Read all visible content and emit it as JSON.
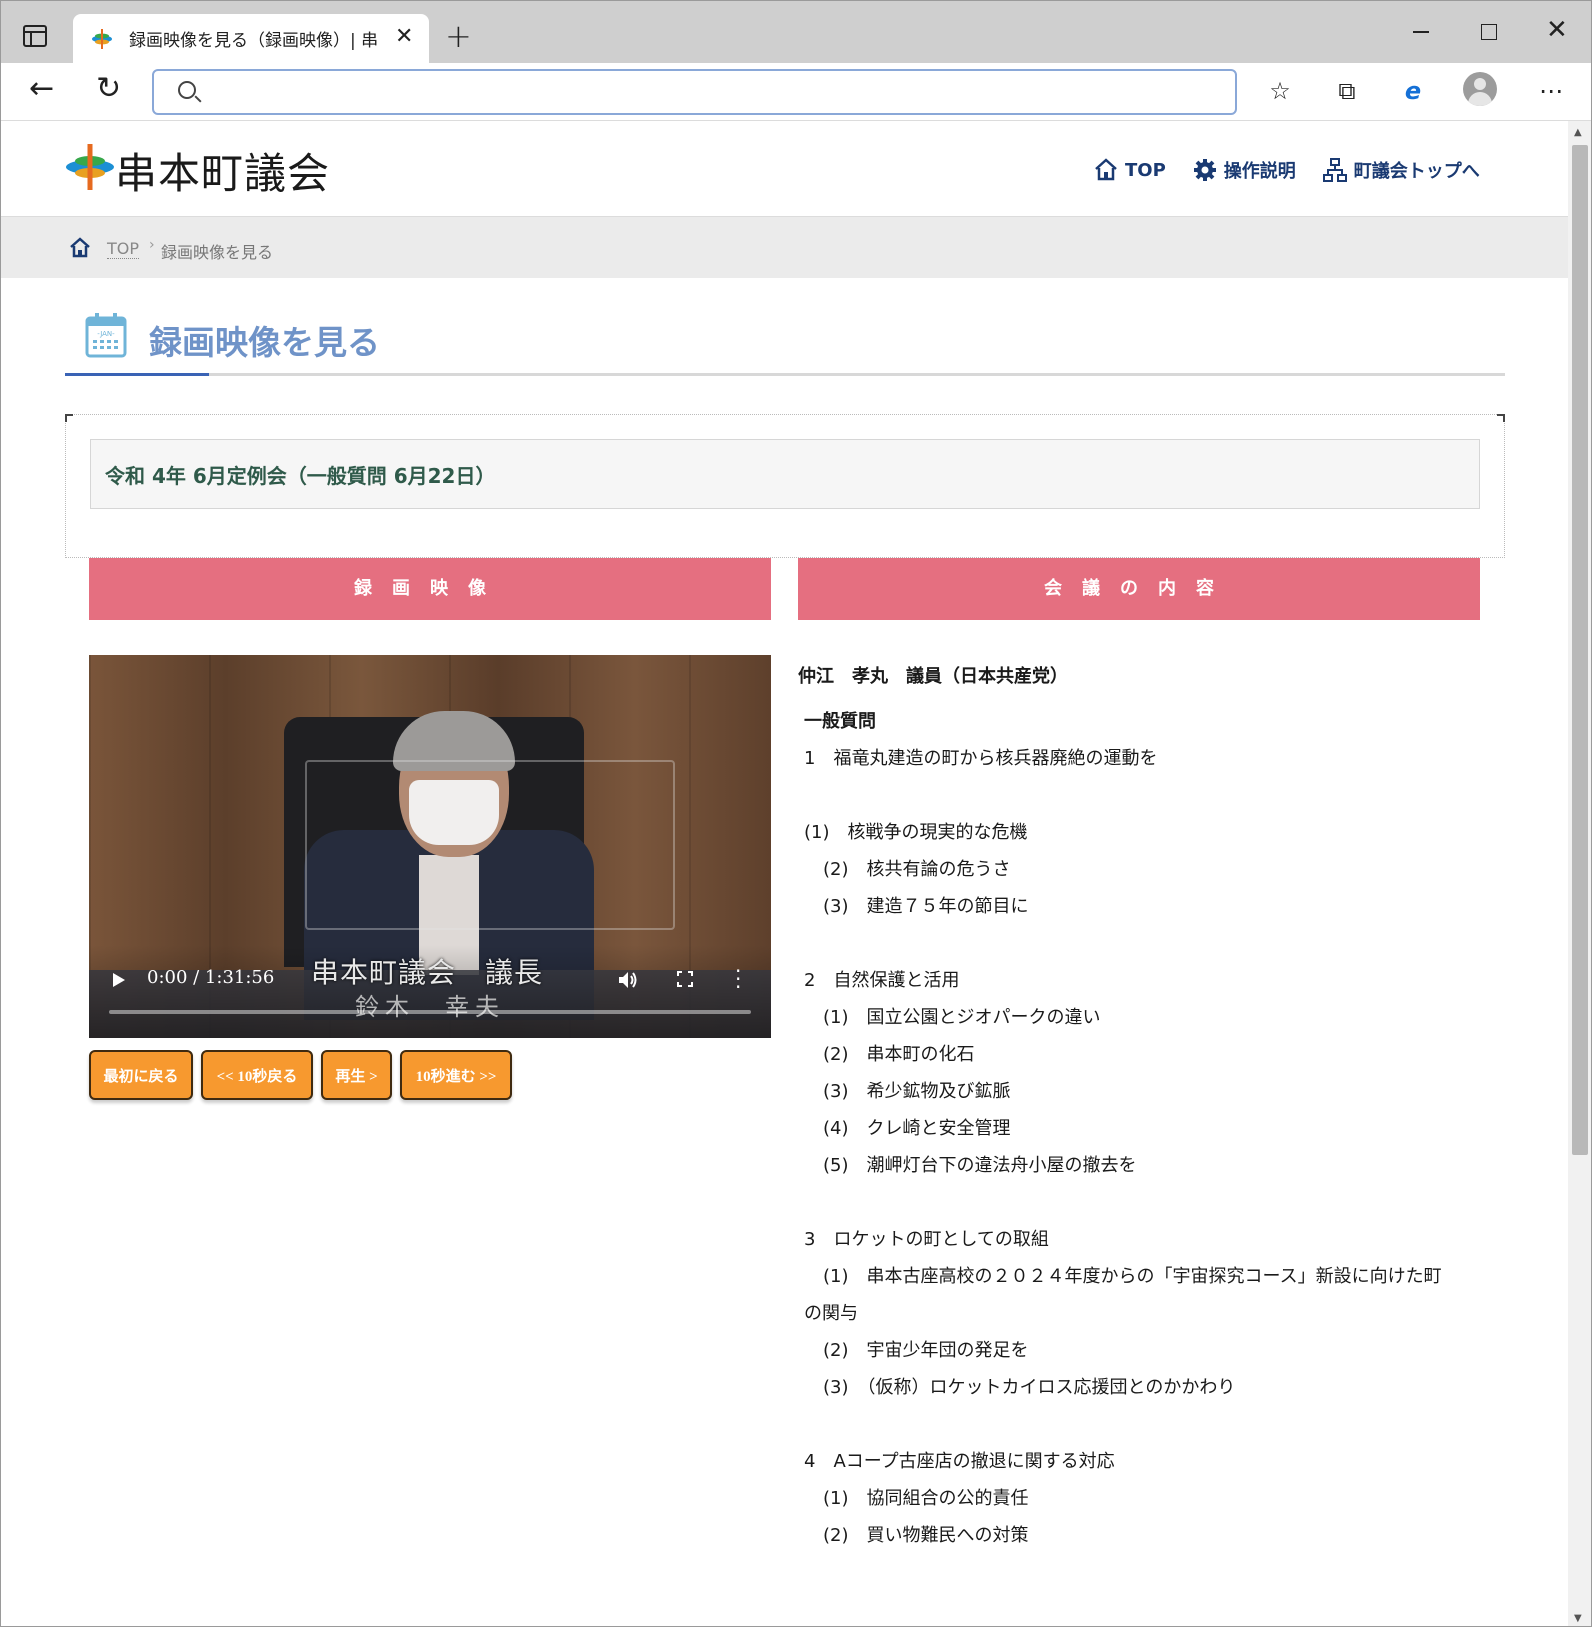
{
  "browser": {
    "tab_title": "録画映像を見る（録画映像）| 串",
    "tab_close": "✕",
    "new_tab": "+",
    "address_value": "",
    "more": "⋯"
  },
  "site": {
    "name": "串本町議会",
    "nav": [
      {
        "label": "TOP",
        "icon": "home-icon"
      },
      {
        "label": "操作説明",
        "icon": "gear-icon"
      },
      {
        "label": "町議会トップへ",
        "icon": "sitemap-icon"
      }
    ],
    "accent_color": "#1a3a72"
  },
  "breadcrumb": {
    "top": "TOP",
    "separator": "›",
    "current": "録画映像を見る"
  },
  "page": {
    "heading": "録画映像を見る",
    "heading_color": "#6f93c8",
    "meeting_title": "令和 4年 6月定例会（一般質問 6月22日）"
  },
  "sections": {
    "video_header": "録画映像",
    "content_header": "会議の内容",
    "header_color": "#e56f80"
  },
  "video": {
    "time": "0:00 / 1:31:56",
    "caption_line1": "串本町議会　議長",
    "caption_line2": "鈴木　幸夫",
    "progress": 0
  },
  "controls": {
    "first": "最初に戻る",
    "back10": "<< 10秒戻る",
    "play": "再生 >",
    "fwd10": "10秒進む >>",
    "button_color": "#f7992f"
  },
  "content": {
    "speaker": "仲江　孝丸　議員（日本共産党）",
    "category": "一般質問",
    "lines": [
      "1　福竜丸建造の町から核兵器廃絶の運動を",
      "(1)　核戦争の現実的な危機",
      "(2)　核共有論の危うさ",
      "(3)　建造７５年の節目に",
      "2　自然保護と活用",
      "(1)　国立公園とジオパークの違い",
      "(2)　串本町の化石",
      "(3)　希少鉱物及び鉱脈",
      "(4)　クレ崎と安全管理",
      "(5)　潮岬灯台下の違法舟小屋の撤去を",
      "3　ロケットの町としての取組",
      "(1)　串本古座高校の２０２４年度からの「宇宙探究コース」新設に向けた町",
      "の関与",
      "(2)　宇宙少年団の発足を",
      "(3)　（仮称）ロケットカイロス応援団とのかかわり",
      "4　Aコープ古座店の撤退に関する対応",
      "(1)　協同組合の公的責任",
      "(2)　買い物難民への対策"
    ]
  }
}
